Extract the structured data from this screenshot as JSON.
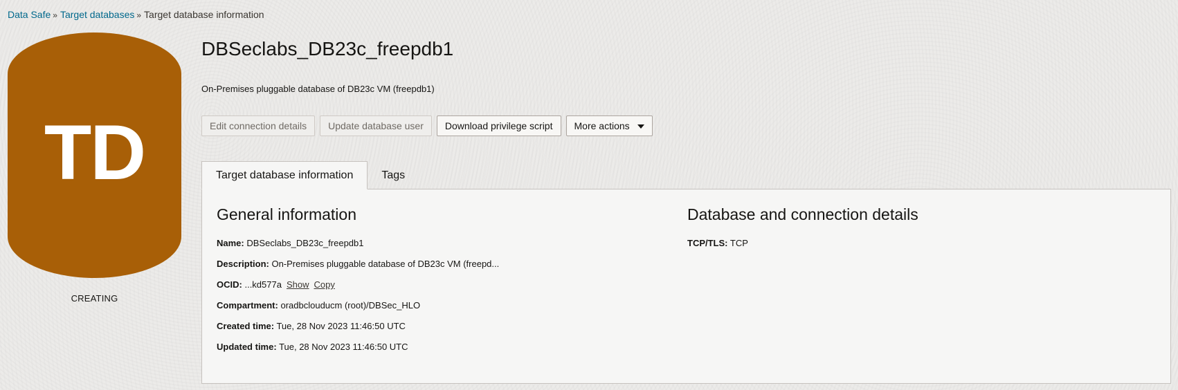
{
  "breadcrumb": {
    "items": [
      "Data Safe",
      "Target databases"
    ],
    "current": "Target database information",
    "separator": "»"
  },
  "avatar": {
    "initials": "TD",
    "status": "CREATING",
    "color": "#a85f07"
  },
  "header": {
    "title": "DBSeclabs_DB23c_freepdb1",
    "subtitle": "On-Premises pluggable database of DB23c VM (freepdb1)"
  },
  "actions": {
    "edit_connection": "Edit connection details",
    "update_user": "Update database user",
    "download_script": "Download privilege script",
    "more_actions": "More actions"
  },
  "tabs": [
    {
      "label": "Target database information",
      "active": true
    },
    {
      "label": "Tags",
      "active": false
    }
  ],
  "general": {
    "title": "General information",
    "name_label": "Name:",
    "name_value": "DBSeclabs_DB23c_freepdb1",
    "description_label": "Description:",
    "description_value": "On-Premises pluggable database of DB23c VM (freepd...",
    "ocid_label": "OCID:",
    "ocid_value": "...kd577a",
    "ocid_show": "Show",
    "ocid_copy": "Copy",
    "compartment_label": "Compartment:",
    "compartment_value": "oradbclouducm (root)/DBSec_HLO",
    "created_label": "Created time:",
    "created_value": "Tue, 28 Nov 2023 11:46:50 UTC",
    "updated_label": "Updated time:",
    "updated_value": "Tue, 28 Nov 2023 11:46:50 UTC"
  },
  "connection": {
    "title": "Database and connection details",
    "tcp_label": "TCP/TLS:",
    "tcp_value": "TCP"
  }
}
